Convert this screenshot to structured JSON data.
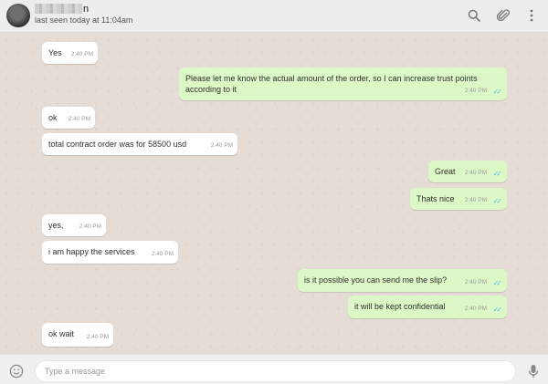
{
  "header": {
    "contact_name_suffix": "n",
    "last_seen": "last seen today at 11:04am",
    "icons": [
      "search-icon",
      "attach-icon",
      "menu-icon"
    ]
  },
  "messages": [
    {
      "direction": "in",
      "text": "Yes",
      "time": "2:40 PM"
    },
    {
      "direction": "out",
      "text": "Please let me know the actual amount of the order, so I can increase trust points according to it",
      "time": "2:40 PM",
      "status": "read"
    },
    {
      "direction": "in",
      "text": "ok",
      "time": "2:40 PM"
    },
    {
      "direction": "in",
      "text": "total contract order was for 58500 usd",
      "time": "2:40 PM"
    },
    {
      "direction": "out",
      "text": "Great",
      "time": "2:40 PM",
      "status": "read"
    },
    {
      "direction": "out",
      "text": "Thats nice",
      "time": "2:40 PM",
      "status": "read"
    },
    {
      "direction": "in",
      "text": "yes,",
      "time": "2:40 PM"
    },
    {
      "direction": "in",
      "text": "i am happy the services",
      "time": "2:40 PM"
    },
    {
      "direction": "out",
      "text": "is it possible you can send me the slip?",
      "time": "2:40 PM",
      "status": "read"
    },
    {
      "direction": "out",
      "text": "it will be kept confidential",
      "time": "2:40 PM",
      "status": "read"
    },
    {
      "direction": "in",
      "text": "ok wait",
      "time": "2:40 PM"
    }
  ],
  "composer": {
    "placeholder": "Type a message",
    "icons": [
      "emoji-icon",
      "microphone-icon"
    ]
  },
  "colors": {
    "chat_background": "#e5ddd5",
    "incoming_bubble": "#ffffff",
    "outgoing_bubble": "#dcf8c6",
    "read_ticks": "#4fc3f7",
    "header_background": "#ededed"
  }
}
